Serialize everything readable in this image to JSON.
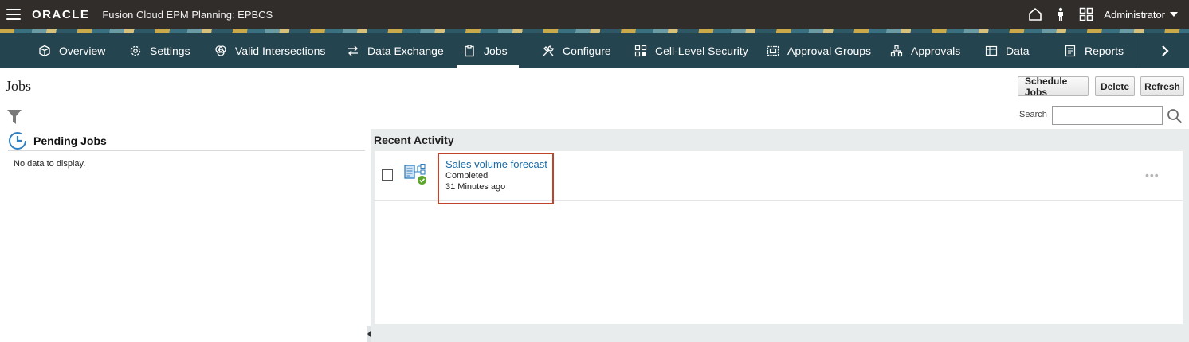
{
  "header": {
    "logo_text": "ORACLE",
    "app_title": "Fusion Cloud EPM Planning: EPBCS",
    "user": "Administrator"
  },
  "nav": {
    "items": [
      {
        "label": "Overview",
        "icon": "cube-icon"
      },
      {
        "label": "Settings",
        "icon": "gear-icon"
      },
      {
        "label": "Valid Intersections",
        "icon": "intersect-icon"
      },
      {
        "label": "Data Exchange",
        "icon": "exchange-arrows-icon"
      },
      {
        "label": "Jobs",
        "icon": "clipboard-icon",
        "active": true
      },
      {
        "label": "Configure",
        "icon": "tools-icon"
      },
      {
        "label": "Cell-Level Security",
        "icon": "grid-security-icon"
      },
      {
        "label": "Approval Groups",
        "icon": "approval-groups-icon"
      },
      {
        "label": "Approvals",
        "icon": "hierarchy-icon"
      },
      {
        "label": "Data",
        "icon": "table-icon"
      },
      {
        "label": "Reports",
        "icon": "report-icon"
      }
    ]
  },
  "page": {
    "title": "Jobs",
    "buttons": {
      "schedule": "Schedule Jobs",
      "delete": "Delete",
      "refresh": "Refresh"
    },
    "search_label": "Search",
    "search_value": ""
  },
  "pending": {
    "title": "Pending Jobs",
    "empty_text": "No data to display."
  },
  "recent": {
    "title": "Recent Activity",
    "jobs": [
      {
        "name": "Sales volume forecast",
        "status": "Completed",
        "time": "31 Minutes ago",
        "more": "•••"
      }
    ]
  },
  "colors": {
    "topbar": "#312d2a",
    "navbar": "#24444f",
    "link": "#1b6aa5",
    "highlight": "#c0432b",
    "status_ok": "#5aa52a"
  }
}
